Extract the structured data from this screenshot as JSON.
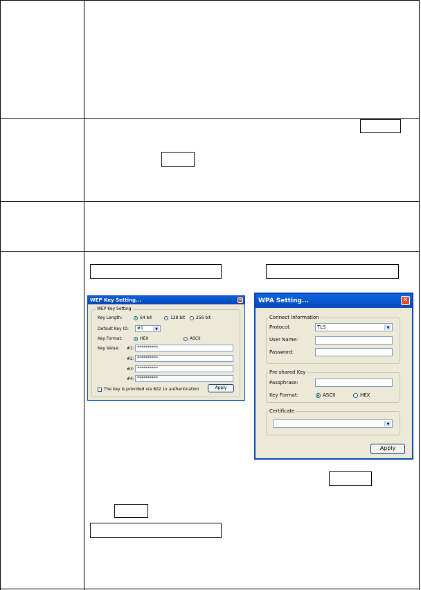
{
  "wep_dialog": {
    "title": "WEP Key Setting...",
    "group_title": "WEP Key Setting",
    "key_length_label": "Key Length:",
    "key_length_options": [
      "64 bit",
      "128 bit",
      "256 bit"
    ],
    "key_length_selected": "64 bit",
    "default_key_id_label": "Default Key ID:",
    "default_key_id_value": "#1",
    "key_format_label": "Key Format:",
    "key_format_options": [
      "HEX",
      "ASCII"
    ],
    "key_format_selected": "HEX",
    "key_value_label": "Key Value:",
    "key_labels": [
      "#1:",
      "#2:",
      "#3:",
      "#4:"
    ],
    "key_values": [
      "**********",
      "**********",
      "**********",
      "**********"
    ],
    "checkbox_label": "The key is provided via 802.1x authentication",
    "apply_label": "Apply"
  },
  "wpa_dialog": {
    "title": "WPA Setting...",
    "connect_group_title": "Connect Information",
    "protocol_label": "Protocol:",
    "protocol_value": "TLS",
    "username_label": "User Name:",
    "username_value": "",
    "password_label": "Password:",
    "password_value": "",
    "psk_group_title": "Pre-shared Key",
    "passphrase_label": "Passphrase:",
    "passphrase_value": "",
    "key_format_label": "Key Format:",
    "key_format_options": [
      "ASCII",
      "HEX"
    ],
    "key_format_selected": "ASCII",
    "certificate_group_title": "Certificate",
    "certificate_value": "",
    "apply_label": "Apply"
  },
  "colors": {
    "titlebar_blue": "#0a5fd8",
    "dialog_face": "#ece9d8",
    "close_button": "#d8502a",
    "radio_selected": "#21a121"
  }
}
